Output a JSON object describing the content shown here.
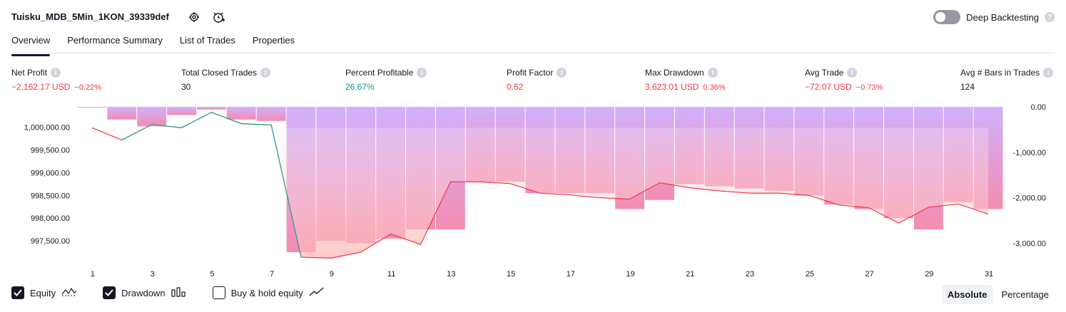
{
  "header": {
    "strategy_name": "Tuisku_MDB_5Min_1KON_39339def",
    "deep_backtesting_label": "Deep Backtesting",
    "help_glyph": "?"
  },
  "tabs": [
    "Overview",
    "Performance Summary",
    "List of Trades",
    "Properties"
  ],
  "metrics": [
    {
      "label": "Net Profit",
      "value": "−2,162.17 USD",
      "sub": "−0.22%",
      "color": "red"
    },
    {
      "label": "Total Closed Trades",
      "value": "30",
      "sub": "",
      "color": "default"
    },
    {
      "label": "Percent Profitable",
      "value": "26.67%",
      "sub": "",
      "color": "green"
    },
    {
      "label": "Profit Factor",
      "value": "0.62",
      "sub": "",
      "color": "red"
    },
    {
      "label": "Max Drawdown",
      "value": "3,623.01 USD",
      "sub": "0.36%",
      "color": "red"
    },
    {
      "label": "Avg Trade",
      "value": "−72.07 USD",
      "sub": "−0.73%",
      "color": "red"
    },
    {
      "label": "Avg # Bars in Trades",
      "value": "124",
      "sub": "",
      "color": "default"
    }
  ],
  "chart_data": {
    "type": "line",
    "x": [
      1,
      2,
      3,
      4,
      5,
      6,
      7,
      8,
      9,
      10,
      11,
      12,
      13,
      14,
      15,
      16,
      17,
      18,
      19,
      20,
      21,
      22,
      23,
      24,
      25,
      26,
      27,
      28,
      29,
      30,
      31
    ],
    "x_ticks": [
      "1",
      "3",
      "5",
      "7",
      "9",
      "11",
      "13",
      "15",
      "17",
      "19",
      "21",
      "23",
      "25",
      "27",
      "29",
      "31"
    ],
    "series": [
      {
        "name": "Equity",
        "axis": "left",
        "values": [
          999990,
          999720,
          1000060,
          999990,
          1000330,
          1000080,
          1000050,
          997140,
          997120,
          997250,
          997650,
          997420,
          998800,
          998800,
          998760,
          998550,
          998510,
          998450,
          998420,
          998780,
          998670,
          998600,
          998550,
          998550,
          998500,
          998290,
          998230,
          997890,
          998240,
          998310,
          998090
        ]
      },
      {
        "name": "Drawdown",
        "axis": "right",
        "type": "bar",
        "values": [
          0,
          -280,
          -430,
          -180,
          -60,
          -280,
          -310,
          -3200,
          -2950,
          -3000,
          -2900,
          -2700,
          -2700,
          -1650,
          -1650,
          -1900,
          -1900,
          -1900,
          -2250,
          -2050,
          -1700,
          -1750,
          -1800,
          -1850,
          -1950,
          -2150,
          -2250,
          -2450,
          -2700,
          -2100,
          -2250
        ]
      }
    ],
    "left_ticks": [
      "1,000,000.00",
      "999,500.00",
      "999,000.00",
      "998,500.00",
      "998,000.00",
      "997,500.00"
    ],
    "right_ticks": [
      "0.00",
      "-1,000.00",
      "-2,000.00",
      "-3,000.00"
    ],
    "ylim_left": [
      997000,
      1000450
    ],
    "ylim_right": [
      -3450,
      0
    ],
    "colors": {
      "equity_above": "#22ab94",
      "equity_below": "#f23645",
      "drawdown_bar": "#c9a3fc",
      "drawdown_bar_under": "#f178a4"
    }
  },
  "legend": [
    {
      "label": "Equity",
      "checked": true,
      "icon": "equity-line-icon"
    },
    {
      "label": "Drawdown",
      "checked": true,
      "icon": "drawdown-bars-icon"
    },
    {
      "label": "Buy & hold equity",
      "checked": false,
      "icon": "buy-hold-line-icon"
    }
  ],
  "modes": [
    {
      "label": "Absolute",
      "active": true
    },
    {
      "label": "Percentage",
      "active": false
    }
  ]
}
